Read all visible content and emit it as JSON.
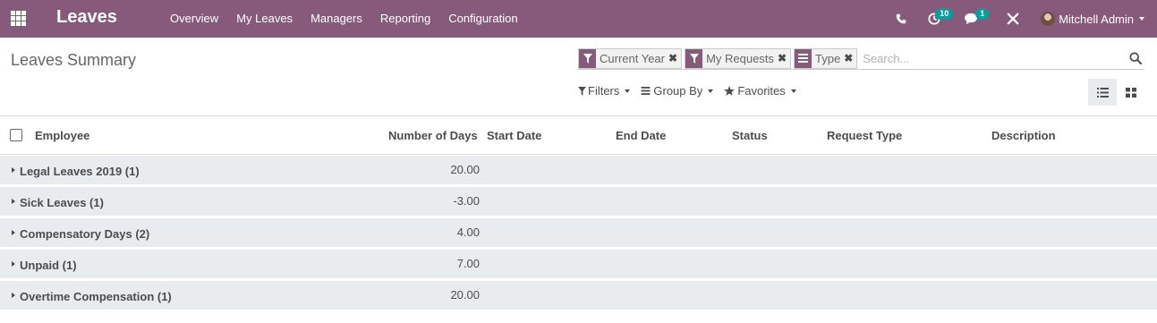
{
  "app": {
    "name": "Leaves",
    "menu": [
      "Overview",
      "My Leaves",
      "Managers",
      "Reporting",
      "Configuration"
    ],
    "systray": {
      "activities_count": "10",
      "messages_count": "1",
      "user_name": "Mitchell Admin"
    }
  },
  "control_panel": {
    "title": "Leaves Summary",
    "facets": [
      {
        "label": "Current Year",
        "icon": "filter-icon"
      },
      {
        "label": "My Requests",
        "icon": "filter-icon"
      },
      {
        "label": "Type",
        "icon": "group-by-icon"
      }
    ],
    "search_placeholder": "Search...",
    "filters_label": "Filters",
    "group_by_label": "Group By",
    "favorites_label": "Favorites"
  },
  "table": {
    "columns": [
      "Employee",
      "Number of Days",
      "Start Date",
      "End Date",
      "Status",
      "Request Type",
      "Description"
    ],
    "groups": [
      {
        "name": "Legal Leaves 2019 (1)",
        "days": "20.00"
      },
      {
        "name": "Sick Leaves (1)",
        "days": "-3.00"
      },
      {
        "name": "Compensatory Days (2)",
        "days": "4.00"
      },
      {
        "name": "Unpaid (1)",
        "days": "7.00"
      },
      {
        "name": "Overtime Compensation (1)",
        "days": "20.00"
      }
    ]
  },
  "colors": {
    "brand": "#875a7b",
    "badge": "#00a09d",
    "group_row_bg": "#e9ecef"
  }
}
